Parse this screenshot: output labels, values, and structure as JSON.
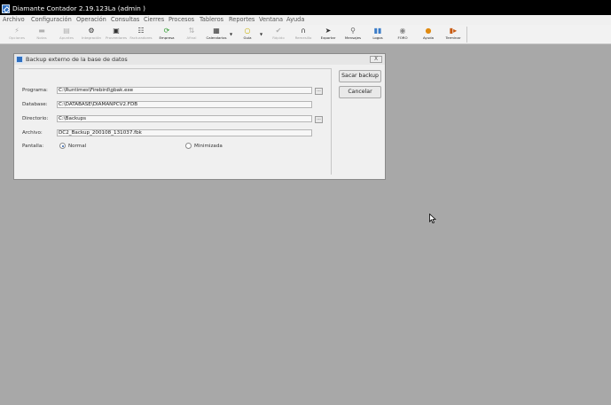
{
  "window": {
    "title": "Diamante Contador 2.19.123La (admin )"
  },
  "menu": [
    "Archivo",
    "Configuración",
    "Operación",
    "Consultas",
    "Cierres",
    "Procesos",
    "Tableros",
    "Reportes",
    "Ventana",
    "Ayuda"
  ],
  "toolbar": [
    {
      "label": "Opciones",
      "icon": "lightning-icon",
      "enabled": false
    },
    {
      "label": "Notas",
      "icon": "notes-icon",
      "enabled": false
    },
    {
      "label": "Apuntes",
      "icon": "notebook-icon",
      "enabled": false
    },
    {
      "label": "Integración",
      "icon": "integration-icon",
      "enabled": false
    },
    {
      "label": "Proveedores",
      "icon": "providers-icon",
      "enabled": false
    },
    {
      "label": "Facturadores",
      "icon": "billing-icon",
      "enabled": false
    },
    {
      "label": "Empresa",
      "icon": "refresh-icon",
      "enabled": true
    },
    {
      "label": "Afinal",
      "icon": "adjust-icon",
      "enabled": false
    },
    {
      "label": "Calendarios",
      "icon": "calendar-icon",
      "enabled": true
    },
    {
      "label": "Guía",
      "icon": "chat-icon",
      "enabled": true
    },
    {
      "label": "Rápido",
      "icon": "quick-icon",
      "enabled": false
    },
    {
      "label": "Remesillo",
      "icon": "remesa-icon",
      "enabled": false
    },
    {
      "label": "Exportar",
      "icon": "export-icon",
      "enabled": true
    },
    {
      "label": "Mensajes",
      "icon": "search-icon",
      "enabled": true
    },
    {
      "label": "Logos",
      "icon": "logos-icon",
      "enabled": true
    },
    {
      "label": "FORO",
      "icon": "forum-icon",
      "enabled": true
    },
    {
      "label": "Ayuda",
      "icon": "help-icon",
      "enabled": true
    },
    {
      "label": "Terminar",
      "icon": "exit-icon",
      "enabled": true
    }
  ],
  "dialog": {
    "title": "Backup externo de la base de datos",
    "close_label": "X",
    "fields": [
      {
        "label": "Programa:",
        "value": "C:\\Runtimes\\Firebird\\gbak.exe",
        "browse": true
      },
      {
        "label": "Database:",
        "value": "C:\\DATABASE\\DIAMANPCV2.FDB",
        "browse": false
      },
      {
        "label": "Directorio:",
        "value": "C:\\Backups",
        "browse": true
      },
      {
        "label": "Archivo:",
        "value": "DC2_Backup_200108_131037.fbk",
        "browse": false
      }
    ],
    "browse_label": "...",
    "pantalla_label": "Pantalla:",
    "options": [
      {
        "label": "Normal",
        "checked": true
      },
      {
        "label": "Minimizada",
        "checked": false
      }
    ],
    "buttons": {
      "backup": "Sacar backup",
      "cancel": "Cancelar"
    }
  }
}
